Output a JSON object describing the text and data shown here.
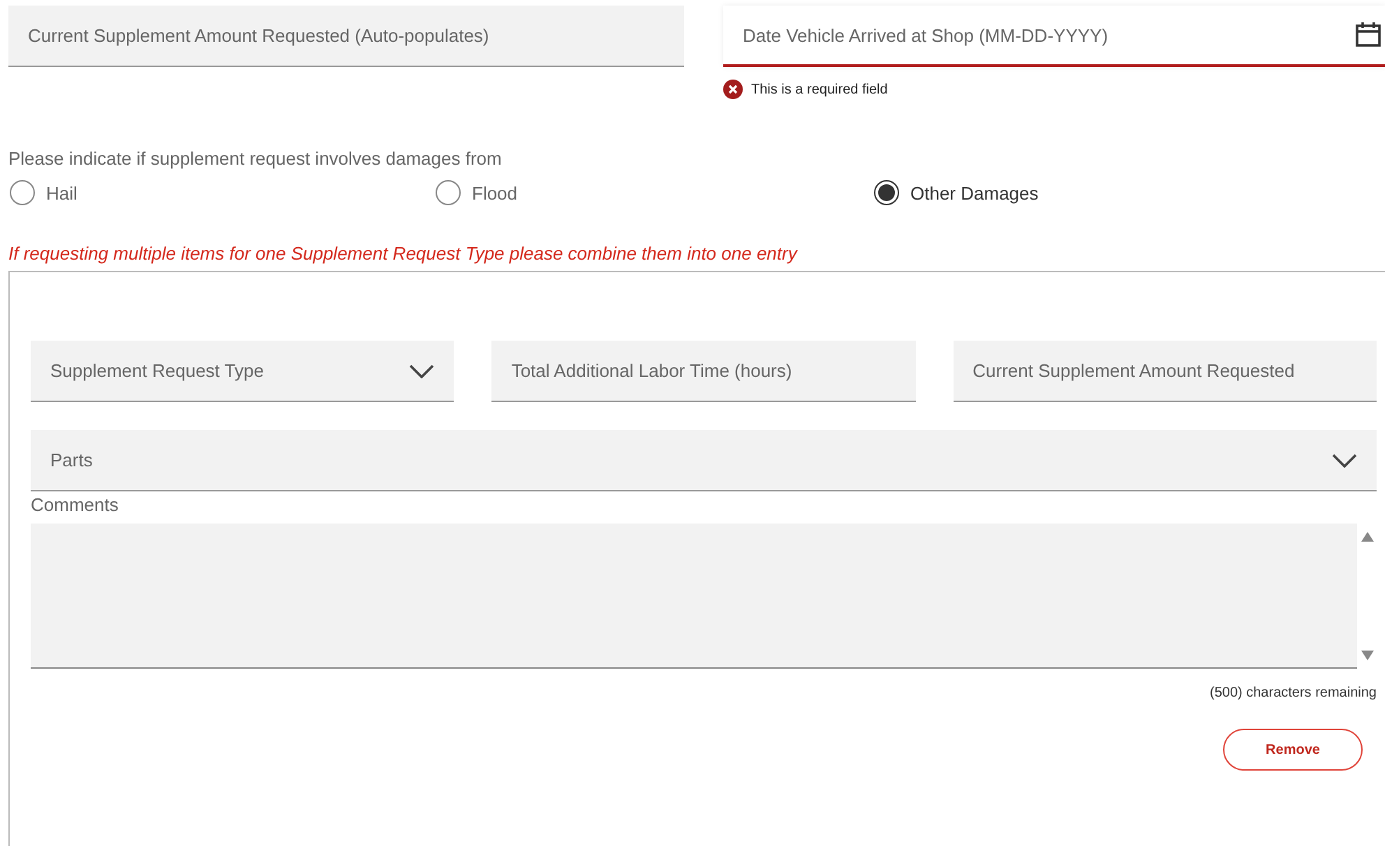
{
  "top_fields": [
    {
      "kind": "text",
      "placeholder": "Current Supplement Amount Requested (Auto-populates)"
    },
    {
      "kind": "date",
      "placeholder": "Date Vehicle Arrived at Shop (MM-DD-YYYY)",
      "error": "This is a required field"
    }
  ],
  "damage_question": {
    "label": "Please indicate if supplement request involves damages from",
    "options": [
      {
        "label": "Hail",
        "selected": false
      },
      {
        "label": "Flood",
        "selected": false
      },
      {
        "label": "Other Damages",
        "selected": true
      }
    ]
  },
  "note": "If requesting multiple items for one Supplement Request Type please combine them into one entry",
  "entry": {
    "fields": [
      {
        "kind": "select",
        "placeholder": "Supplement Request Type"
      },
      {
        "kind": "text",
        "placeholder": "Total Additional Labor Time (hours)"
      },
      {
        "kind": "text",
        "placeholder": "Current Supplement Amount Requested"
      }
    ],
    "parts": {
      "kind": "select",
      "placeholder": "Parts"
    },
    "comments_label": "Comments",
    "counter": "(500) characters remaining",
    "remove_button": "Remove"
  }
}
